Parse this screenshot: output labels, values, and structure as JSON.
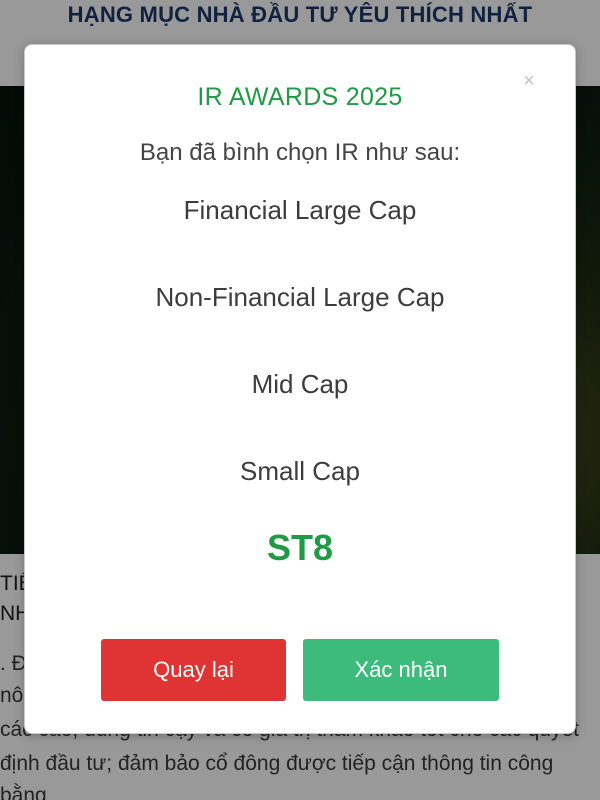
{
  "background": {
    "page_title": "HẠNG MỤC NHÀ ĐẦU TƯ YÊU THÍCH NHẤT",
    "strip_lines": [
      "TIÊ",
      "NH"
    ],
    "body_lines": [
      ". Đ",
      "nô",
      "các cáo, đúng tin cậy và có giá trị tham khảo tốt cho các quyết",
      "định đầu tư; đảm bảo cổ đông được tiếp cận thông tin công",
      "bằng"
    ]
  },
  "modal": {
    "title": "IR AWARDS 2025",
    "subtitle": "Bạn đã bình chọn IR như sau:",
    "categories": [
      "Financial Large Cap",
      "Non-Financial Large Cap",
      "Mid Cap",
      "Small Cap"
    ],
    "selected_company": "ST8",
    "close_glyph": "×",
    "back_label": "Quay lại",
    "confirm_label": "Xác nhận"
  },
  "colors": {
    "accent_green": "#1f9b45",
    "back_button": "#e03434",
    "confirm_button": "#3cbb7c"
  }
}
